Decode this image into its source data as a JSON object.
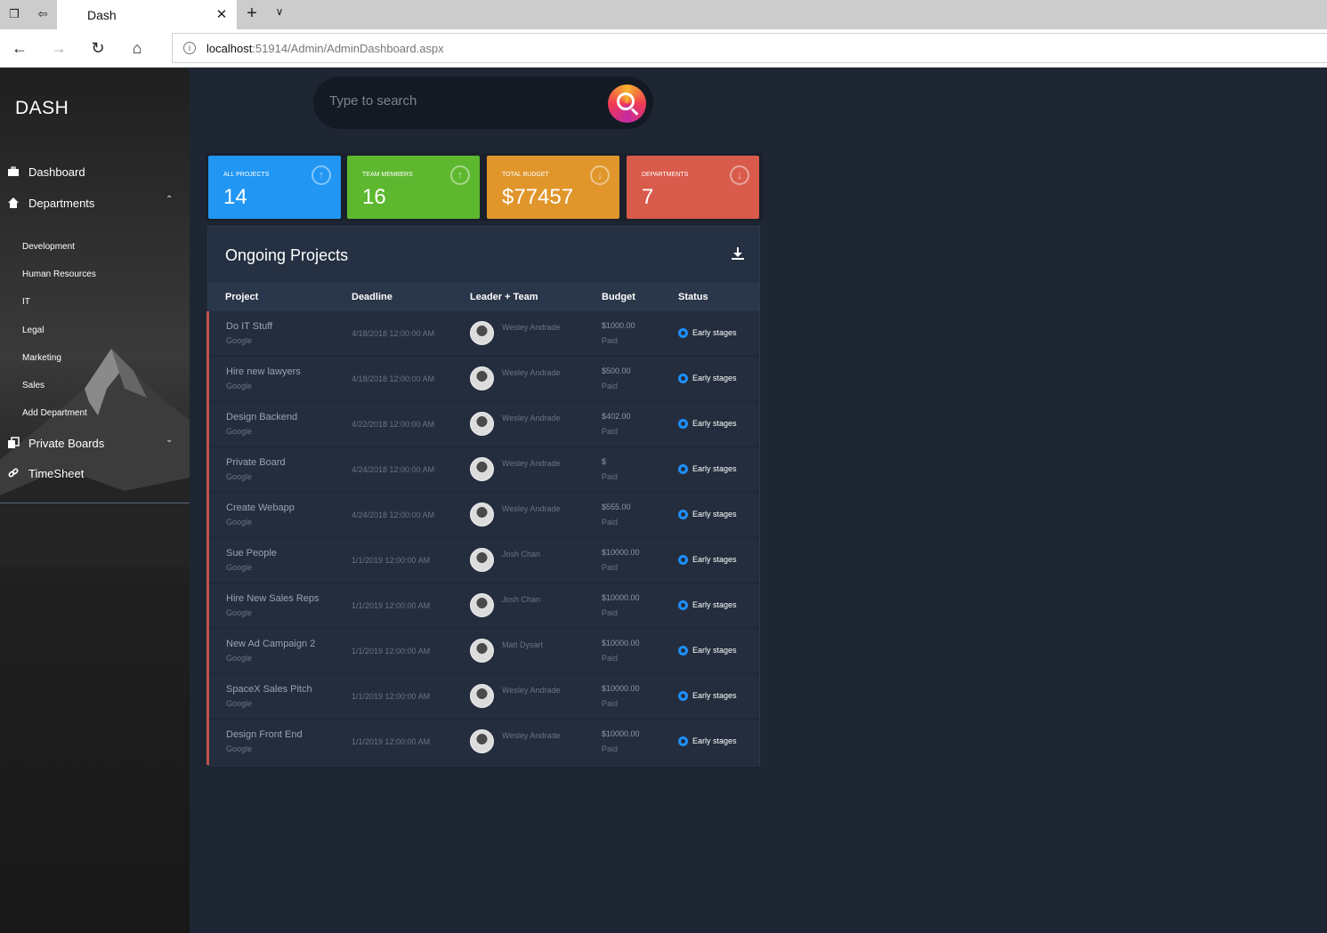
{
  "browser": {
    "tab_title": "Dash",
    "url_host": "localhost",
    "url_rest": ":51914/Admin/AdminDashboard.aspx"
  },
  "sidebar": {
    "brand": "DASH",
    "menu": {
      "dashboard": "Dashboard",
      "departments": "Departments",
      "private_boards": "Private Boards",
      "timesheet": "TimeSheet"
    },
    "departments": [
      "Development",
      "Human Resources",
      "IT",
      "Legal",
      "Marketing",
      "Sales",
      "Add Department"
    ]
  },
  "search": {
    "placeholder": "Type to search"
  },
  "stats": [
    {
      "label": "ALL PROJECTS",
      "value": "14",
      "color": "#2196f3",
      "icon": "arrow-up-circle-icon"
    },
    {
      "label": "TEAM MEMBERS",
      "value": "16",
      "color": "#5db82f",
      "icon": "arrow-up-circle-icon"
    },
    {
      "label": "TOTAL BUDGET",
      "value": "$77457",
      "color": "#e0962b",
      "icon": "arrow-down-circle-icon"
    },
    {
      "label": "DEPARTMENTS",
      "value": "7",
      "color": "#d95b4b",
      "icon": "arrow-down-circle-icon"
    }
  ],
  "projects": {
    "title": "Ongoing Projects",
    "columns": {
      "project": "Project",
      "deadline": "Deadline",
      "leader": "Leader + Team",
      "budget": "Budget",
      "status": "Status"
    },
    "rows": [
      {
        "name": "Do IT Stuff",
        "client": "Google",
        "deadline": "4/18/2018 12:00:00 AM",
        "leader": "Wesley Andrade",
        "budget": "$1000.00",
        "paid": "Paid",
        "status": "Early stages"
      },
      {
        "name": "Hire new lawyers",
        "client": "Google",
        "deadline": "4/18/2018 12:00:00 AM",
        "leader": "Wesley Andrade",
        "budget": "$500.00",
        "paid": "Paid",
        "status": "Early stages"
      },
      {
        "name": "Design Backend",
        "client": "Google",
        "deadline": "4/22/2018 12:00:00 AM",
        "leader": "Wesley Andrade",
        "budget": "$402.00",
        "paid": "Paid",
        "status": "Early stages"
      },
      {
        "name": "Private Board",
        "client": "Google",
        "deadline": "4/24/2018 12:00:00 AM",
        "leader": "Wesley Andrade",
        "budget": "$",
        "paid": "Paid",
        "status": "Early stages"
      },
      {
        "name": "Create Webapp",
        "client": "Google",
        "deadline": "4/24/2018 12:00:00 AM",
        "leader": "Wesley Andrade",
        "budget": "$555.00",
        "paid": "Paid",
        "status": "Early stages"
      },
      {
        "name": "Sue People",
        "client": "Google",
        "deadline": "1/1/2019 12:00:00 AM",
        "leader": "Josh Chan",
        "budget": "$10000.00",
        "paid": "Paid",
        "status": "Early stages"
      },
      {
        "name": "Hire New Sales Reps",
        "client": "Google",
        "deadline": "1/1/2019 12:00:00 AM",
        "leader": "Josh Chan",
        "budget": "$10000.00",
        "paid": "Paid",
        "status": "Early stages"
      },
      {
        "name": "New Ad Campaign 2",
        "client": "Google",
        "deadline": "1/1/2019 12:00:00 AM",
        "leader": "Matt Dysart",
        "budget": "$10000.00",
        "paid": "Paid",
        "status": "Early stages"
      },
      {
        "name": "SpaceX Sales Pitch",
        "client": "Google",
        "deadline": "1/1/2019 12:00:00 AM",
        "leader": "Wesley Andrade",
        "budget": "$10000.00",
        "paid": "Paid",
        "status": "Early stages"
      },
      {
        "name": "Design Front End",
        "client": "Google",
        "deadline": "1/1/2019 12:00:00 AM",
        "leader": "Wesley Andrade",
        "budget": "$10000.00",
        "paid": "Paid",
        "status": "Early stages"
      }
    ]
  }
}
